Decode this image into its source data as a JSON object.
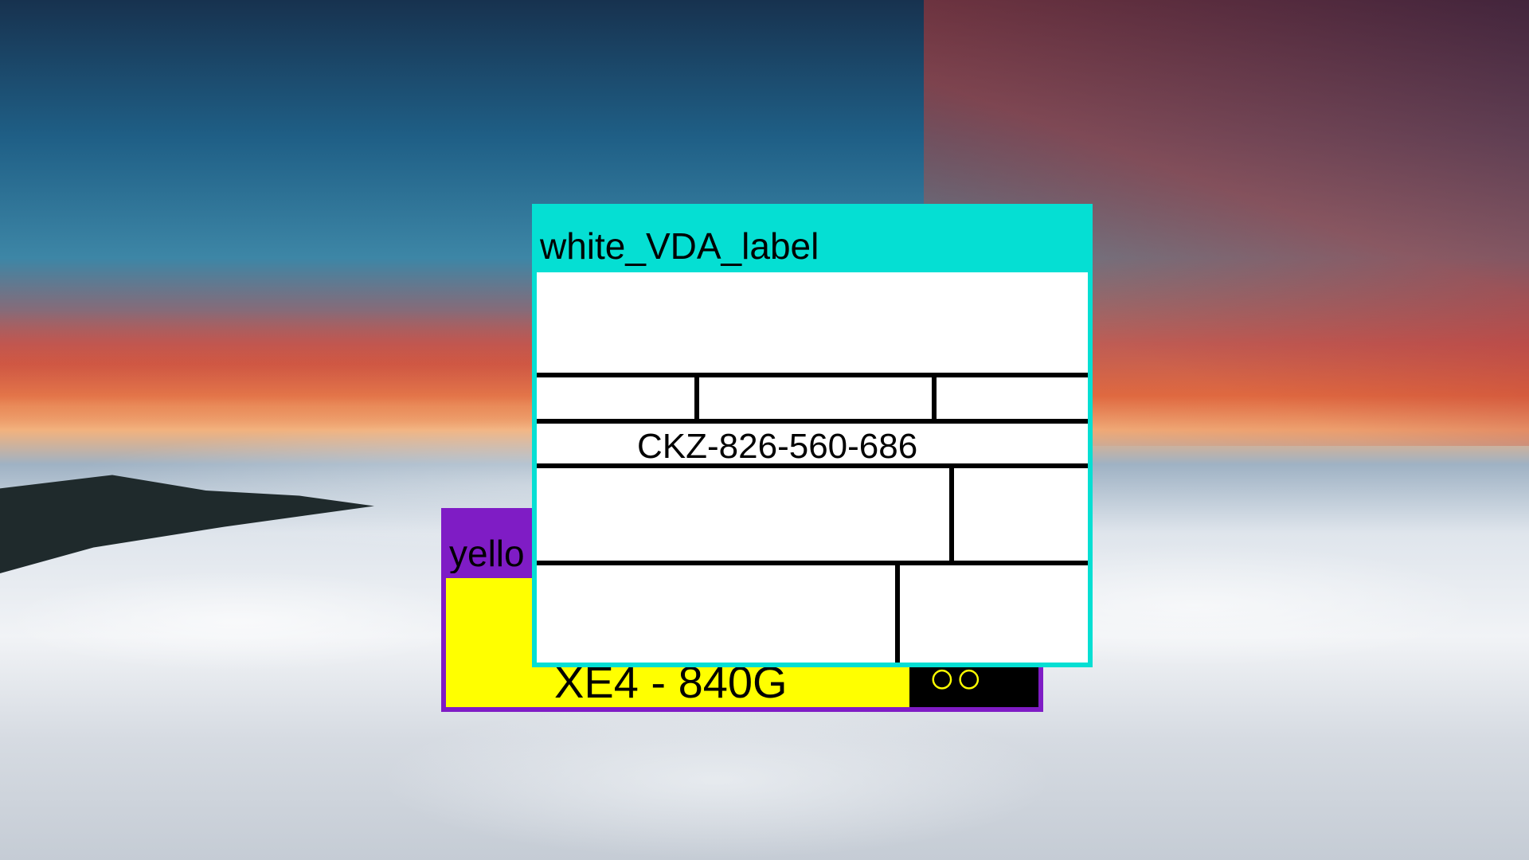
{
  "desktop": {
    "wallpaper": "sunset-sky-over-sea-of-clouds"
  },
  "windows": {
    "yellow": {
      "title": "yello",
      "code": "XE4 - 840G",
      "dark_glyph": "○○",
      "colors": {
        "titlebar": "#7f1cc5",
        "field": "#ffff00",
        "dark": "#000000"
      }
    },
    "vda": {
      "title": "white_VDA_label",
      "code": "CKZ-826-560-686",
      "colors": {
        "titlebar": "#05dfd3",
        "label": "#ffffff",
        "lines": "#000000"
      }
    }
  }
}
